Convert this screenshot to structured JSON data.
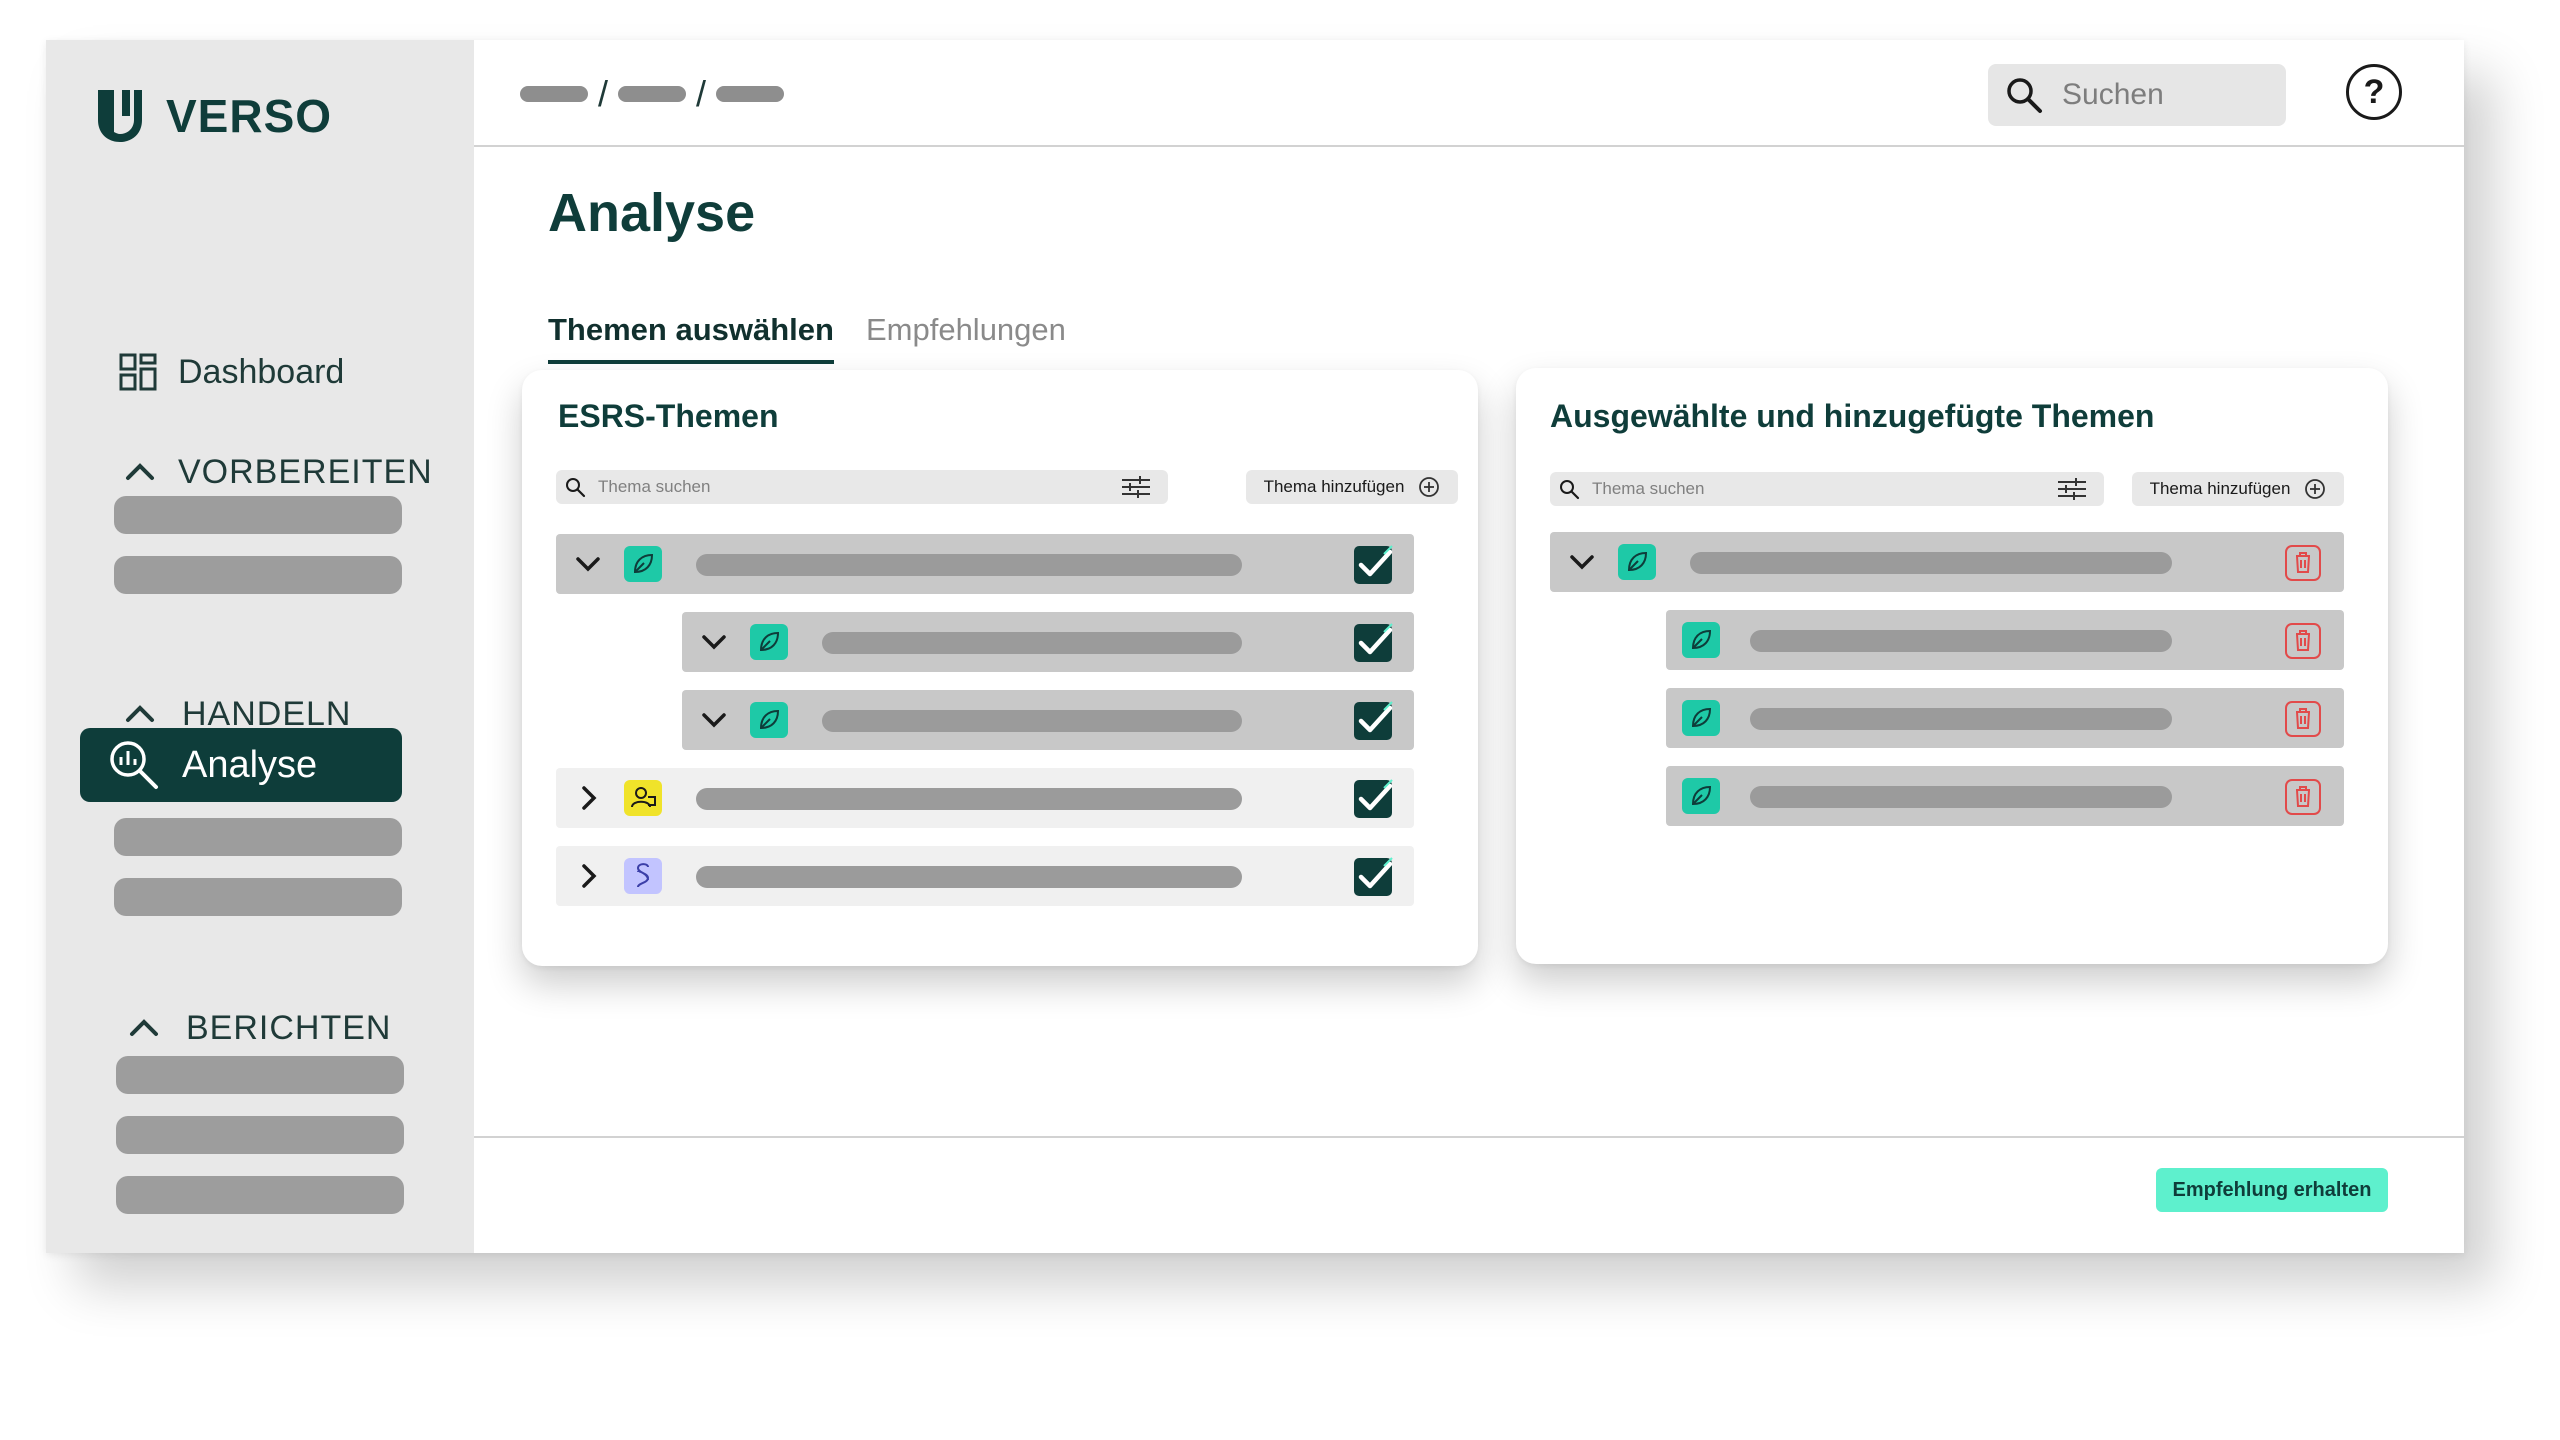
{
  "brand": {
    "name": "VERSO"
  },
  "sidebar": {
    "dashboard_label": "Dashboard",
    "sections": [
      {
        "label": "VORBEREITEN"
      },
      {
        "label": "HANDELN",
        "active_item": "Analyse"
      },
      {
        "label": "BERICHTEN"
      }
    ]
  },
  "topbar": {
    "search_placeholder": "Suchen",
    "help_symbol": "?"
  },
  "page": {
    "title": "Analyse",
    "tabs": [
      {
        "label": "Themen auswählen",
        "active": true
      },
      {
        "label": "Empfehlungen",
        "active": false
      }
    ]
  },
  "esrs_panel": {
    "title": "ESRS-Themen",
    "search_placeholder": "Thema suchen",
    "add_label": "Thema hinzufügen",
    "rows": [
      {
        "level": 0,
        "expanded": true,
        "icon": "leaf-icon",
        "checked": true
      },
      {
        "level": 1,
        "expanded": true,
        "icon": "leaf-icon",
        "checked": true
      },
      {
        "level": 1,
        "expanded": true,
        "icon": "leaf-icon",
        "checked": true
      },
      {
        "level": 0,
        "expanded": false,
        "icon": "people-icon",
        "checked": true
      },
      {
        "level": 0,
        "expanded": false,
        "icon": "paragraph-icon",
        "checked": true
      }
    ]
  },
  "selected_panel": {
    "title": "Ausgewählte und hinzugefügte Themen",
    "search_placeholder": "Thema suchen",
    "add_label": "Thema hinzufügen",
    "rows": [
      {
        "level": 0,
        "expanded": true,
        "icon": "leaf-icon"
      },
      {
        "level": 1,
        "icon": "leaf-icon"
      },
      {
        "level": 1,
        "icon": "leaf-icon"
      },
      {
        "level": 1,
        "icon": "leaf-icon"
      }
    ]
  },
  "footer": {
    "cta_label": "Empfehlung erhalten"
  },
  "colors": {
    "brand_dark": "#0e3d3a",
    "accent_mint": "#5ef0cd",
    "topic_green": "#1ec9a7",
    "topic_yellow": "#f0e32a",
    "topic_lavender": "#c2c4ff",
    "delete_red": "#e24a4a"
  }
}
